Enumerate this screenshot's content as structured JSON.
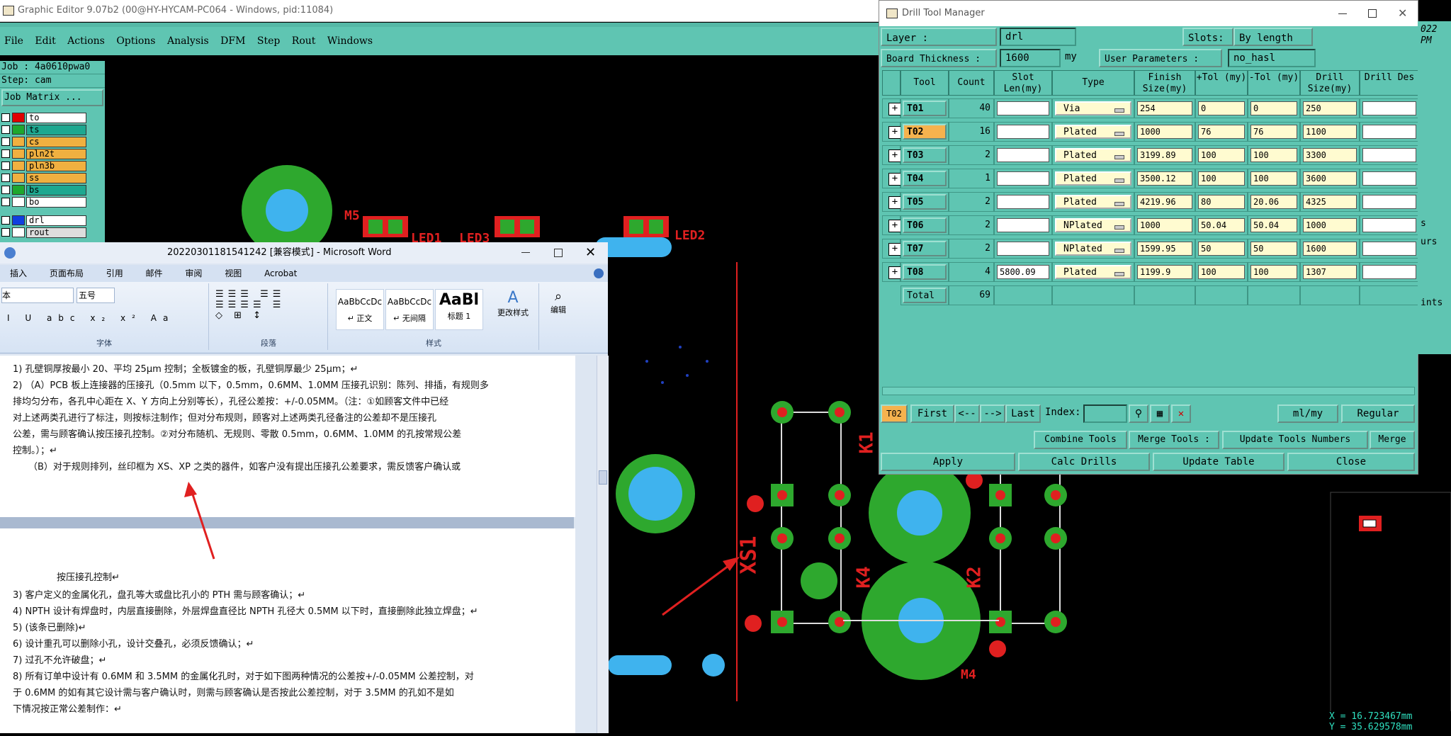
{
  "ge": {
    "title": "Graphic Editor 9.07b2 (00@HY-HYCAM-PC064 - Windows, pid:11084)",
    "menu": [
      "File",
      "Edit",
      "Actions",
      "Options",
      "Analysis",
      "DFM",
      "Step",
      "Rout",
      "Windows"
    ],
    "job": "Job : 4a0610pwa0",
    "step": "Step: cam",
    "job_matrix": "Job Matrix ...",
    "layers": [
      {
        "name": "to",
        "color": "#e00000",
        "bg": "#ffffff"
      },
      {
        "name": "ts",
        "color": "#1ea82e",
        "bg": "#1ea890"
      },
      {
        "name": "cs",
        "color": "#f0b040",
        "bg": "#f0b040"
      },
      {
        "name": "pln2t",
        "color": "#f0b040",
        "bg": "#f0b040"
      },
      {
        "name": "pln3b",
        "color": "#f0b040",
        "bg": "#f0b040"
      },
      {
        "name": "ss",
        "color": "#f0b040",
        "bg": "#f0b040"
      },
      {
        "name": "bs",
        "color": "#1ea82e",
        "bg": "#1ea890"
      },
      {
        "name": "bo",
        "color": "#ffffff",
        "bg": "#ffffff"
      },
      {
        "name": "drl",
        "color": "#1040e0",
        "bg": "#ffffff"
      },
      {
        "name": "rout",
        "color": "#ffffff",
        "bg": "#dddddd"
      }
    ],
    "canvas_labels": {
      "m5": "M5",
      "led1": "LED1",
      "led3": "LED3",
      "led2": "LED2",
      "k1": "K1",
      "xs1": "XS1",
      "k4": "K4",
      "k2": "K2",
      "m4": "M4"
    },
    "status": {
      "x": "X = 16.723467mm",
      "y": "Y = 35.629578mm"
    }
  },
  "word": {
    "title": "20220301181541242 [兼容模式] - Microsoft Word",
    "tabs": [
      "插入",
      "页面布局",
      "引用",
      "邮件",
      "审阅",
      "视图",
      "Acrobat"
    ],
    "font_name": "本",
    "font_size": "五号",
    "groups": [
      "字体",
      "段落",
      "样式",
      "编辑"
    ],
    "styles": [
      {
        "preview": "AaBbCcDc",
        "name": "↵ 正文"
      },
      {
        "preview": "AaBbCcDc",
        "name": "↵ 无间隔"
      },
      {
        "preview": "AaBl",
        "name": "标题 1"
      }
    ],
    "change_styles": "更改样式",
    "edit": "编辑",
    "page1": [
      "1) 孔壁铜厚按最小 20、平均 25μm 控制；全板镀金的板，孔壁铜厚最少 25μm；↵",
      "2) （A）PCB 板上连接器的压接孔（0.5mm 以下，0.5mm，0.6MM、1.0MM 压接孔识别：陈列、排插，有规则多",
      "排均匀分布，各孔中心距在 X、Y 方向上分别等长），孔径公差按：+/-0.05MM。（注：①如顾客文件中已经",
      "对上述两类孔进行了标注，则按标注制作；但对分布规则，顾客对上述两类孔径备注的公差却不是压接孔",
      "公差，需与顾客确认按压接孔控制。②对分布随机、无规则、零散 0.5mm，0.6MM、1.0MM 的孔按常规公差",
      "控制。）；↵",
      "（B）对于规则排列，丝印框为 XS、XP 之类的器件，如客户没有提出压接孔公差要求，需反馈客户确认或"
    ],
    "page2": [
      "按压接孔控制↵",
      "3) 客户定义的金属化孔，盘孔等大或盘比孔小的 PTH 需与顾客确认；↵",
      "4) NPTH 设计有焊盘时，内层直接删除，外层焊盘直径比 NPTH 孔径大 0.5MM 以下时，直接删除此独立焊盘；↵",
      "5) (该条已删除)↵",
      "6) 设计重孔可以删除小孔，设计交叠孔，必须反馈确认；↵",
      "7) 过孔不允许破盘；↵",
      "8) 所有订单中设计有 0.6MM 和 3.5MM 的金属化孔时，对于如下图两种情况的公差按+/-0.05MM 公差控制，对",
      "于 0.6MM 的如有其它设计需与客户确认时，则需与顾客确认是否按此公差控制，对于 3.5MM 的孔如不是如",
      "下情况按正常公差制作：↵"
    ]
  },
  "dtm": {
    "title": "Drill Tool Manager",
    "layer_label": "Layer :",
    "layer_value": "drl",
    "slots_label": "Slots:",
    "slots_value": "By length",
    "board_thickness_label": "Board Thickness :",
    "board_thickness_value": "1600",
    "board_thickness_unit": "my",
    "user_params_label": "User Parameters :",
    "user_params_value": "no_hasl",
    "headers": [
      "Tool",
      "Count",
      "Slot Len(my)",
      "Type",
      "Finish Size(my)",
      "+Tol (my)",
      "-Tol (my)",
      "Drill Size(my)",
      "Drill Des"
    ],
    "rows": [
      {
        "tool": "T01",
        "count": "40",
        "slot": "",
        "type": "Via",
        "finish": "254",
        "ptol": "0",
        "mtol": "0",
        "drill": "250",
        "des": ""
      },
      {
        "tool": "T02",
        "count": "16",
        "slot": "",
        "type": "Plated",
        "finish": "1000",
        "ptol": "76",
        "mtol": "76",
        "drill": "1100",
        "des": ""
      },
      {
        "tool": "T03",
        "count": "2",
        "slot": "",
        "type": "Plated",
        "finish": "3199.89",
        "ptol": "100",
        "mtol": "100",
        "drill": "3300",
        "des": ""
      },
      {
        "tool": "T04",
        "count": "1",
        "slot": "",
        "type": "Plated",
        "finish": "3500.12",
        "ptol": "100",
        "mtol": "100",
        "drill": "3600",
        "des": ""
      },
      {
        "tool": "T05",
        "count": "2",
        "slot": "",
        "type": "Plated",
        "finish": "4219.96",
        "ptol": "80",
        "mtol": "20.06",
        "drill": "4325",
        "des": ""
      },
      {
        "tool": "T06",
        "count": "2",
        "slot": "",
        "type": "NPlated",
        "finish": "1000",
        "ptol": "50.04",
        "mtol": "50.04",
        "drill": "1000",
        "des": ""
      },
      {
        "tool": "T07",
        "count": "2",
        "slot": "",
        "type": "NPlated",
        "finish": "1599.95",
        "ptol": "50",
        "mtol": "50",
        "drill": "1600",
        "des": ""
      },
      {
        "tool": "T08",
        "count": "4",
        "slot": "5800.09",
        "type": "Plated",
        "finish": "1199.9",
        "ptol": "100",
        "mtol": "100",
        "drill": "1307",
        "des": ""
      }
    ],
    "total_label": "Total",
    "total_count": "69",
    "nav": {
      "current": "T02",
      "first": "First",
      "prev": "<--",
      "next": "-->",
      "last": "Last",
      "index_label": "Index:",
      "units": "ml/my",
      "mode": "Regular"
    },
    "buttons": {
      "combine": "Combine Tools",
      "merge_tools": "Merge Tools :",
      "update_numbers": "Update Tools Numbers",
      "merge": "Merge",
      "apply": "Apply",
      "calc": "Calc Drills",
      "update_table": "Update Table",
      "close": "Close"
    },
    "side_fragments": [
      "022",
      "PM",
      "s",
      "urs",
      "ints"
    ]
  }
}
